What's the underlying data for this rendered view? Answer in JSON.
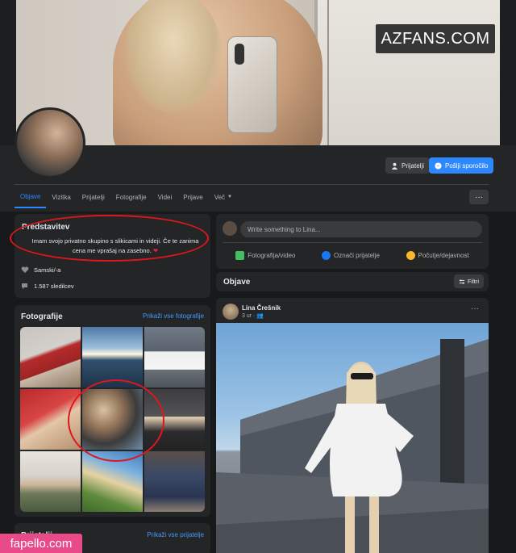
{
  "watermarks": {
    "top": "AZFANS.COM",
    "bottom": "fapello.com"
  },
  "header": {
    "friends_button": "Prijatelji",
    "message_button": "Pošlji sporočilo",
    "tabs": [
      "Objave",
      "Vizitka",
      "Prijatelji",
      "Fotografije",
      "Videi",
      "Prijave",
      "Več"
    ],
    "active_tab": "Objave",
    "more_label": "···"
  },
  "intro": {
    "title": "Predstavitev",
    "bio": "Imam svojo privatno skupino s slikicami in videji. Če te zanima cena me vprašaj na zasebno.",
    "bio_emoji": "❤",
    "relationship": "Samski/-a",
    "followers": "1.587 sledilcev"
  },
  "photos": {
    "title": "Fotografije",
    "link": "Prikaži vse fotografije"
  },
  "friends": {
    "title": "Prijatelji",
    "link": "Prikaži vse prijatelje"
  },
  "composer": {
    "placeholder": "Write something to Lina...",
    "actions": [
      "Fotografija/video",
      "Označi prijatelje",
      "Počutje/dejavnost"
    ]
  },
  "posts": {
    "title": "Objave",
    "filter": "Filtri"
  },
  "post": {
    "author": "Lina Črešnik",
    "time": "3 ur · ",
    "menu": "···"
  },
  "colors": {
    "accent": "#2d88ff",
    "annotation": "#e0161d",
    "background": "#18191a",
    "card": "#242526"
  }
}
